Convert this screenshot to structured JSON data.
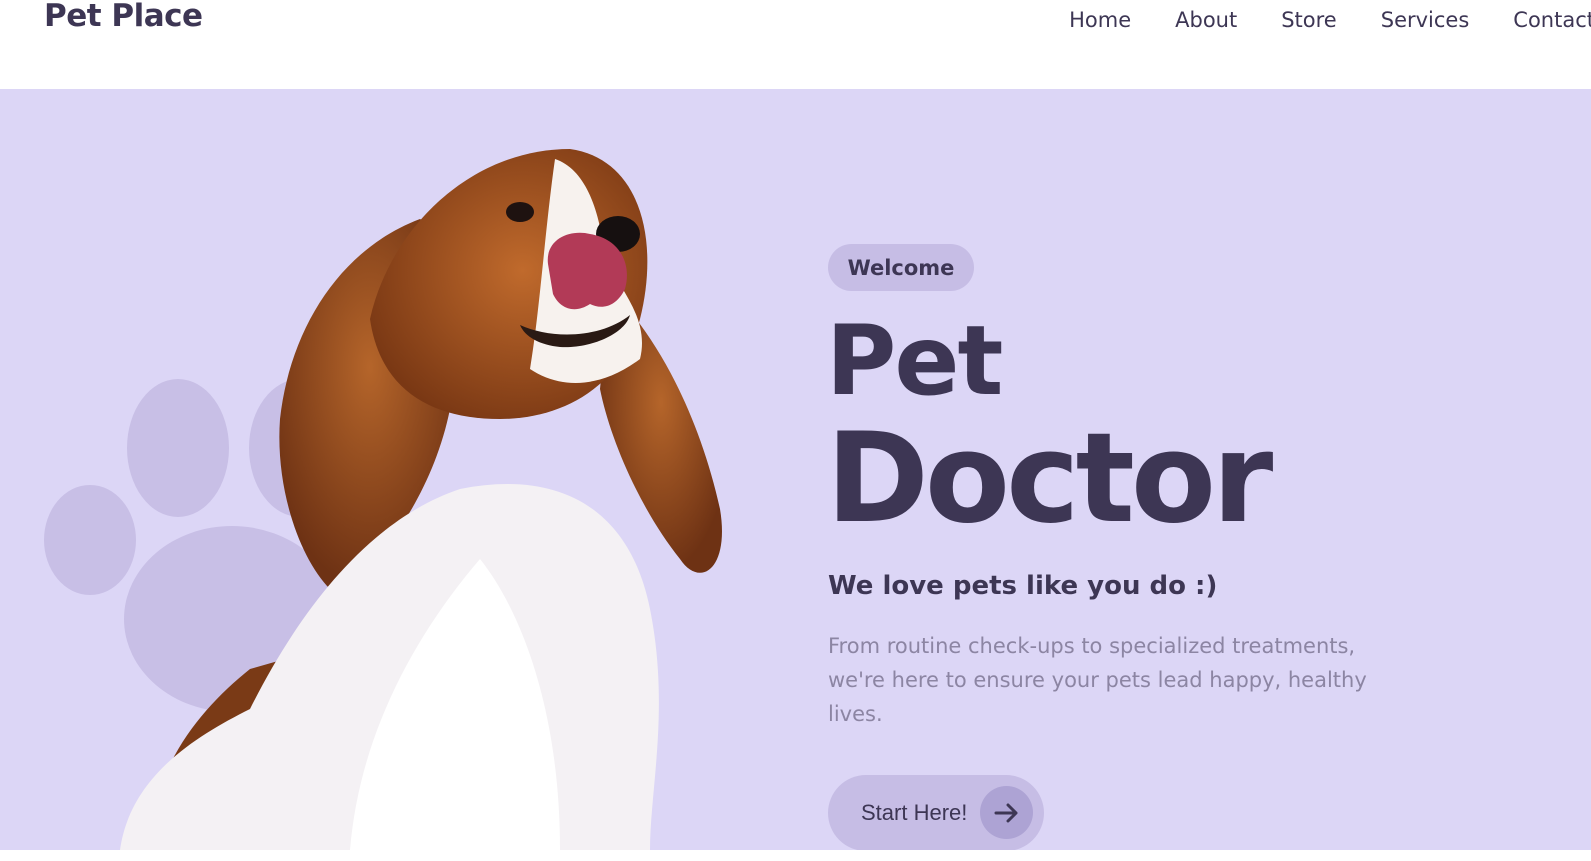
{
  "header": {
    "logo": "Pet Place",
    "nav": [
      "Home",
      "About",
      "Store",
      "Services",
      "Contact"
    ]
  },
  "hero": {
    "badge": "Welcome",
    "title_line1": "Pet",
    "title_line2": "Doctor",
    "tagline": "We love pets like you do :)",
    "description": "From routine check-ups to specialized treatments, we're here to ensure your pets lead happy, healthy lives.",
    "cta_label": "Start Here!",
    "images": [
      "paw-print-icon",
      "dog-photo"
    ]
  },
  "colors": {
    "hero_bg": "#dcd6f6",
    "text_dark": "#3d3654",
    "text_muted": "#8c85a3",
    "pill": "#c6bde5",
    "paw": "#c8bfe6"
  }
}
